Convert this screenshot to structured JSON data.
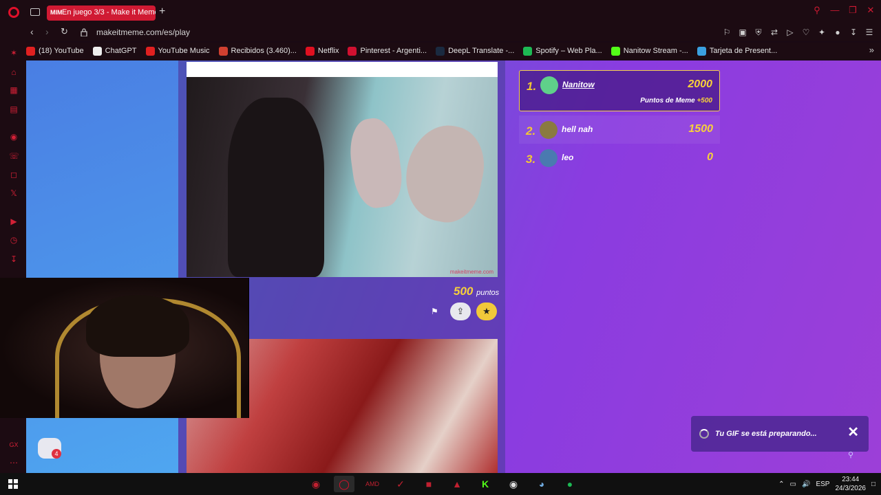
{
  "browser": {
    "tab_title": "En juego 3/3 - Make it Meme",
    "tab_favicon": "MIM",
    "url": "makeitmeme.com/es/play",
    "new_tab": "+"
  },
  "bookmarks": [
    {
      "label": "(18) YouTube",
      "color": "#e02020"
    },
    {
      "label": "ChatGPT",
      "color": "#eeeeee"
    },
    {
      "label": "YouTube Music",
      "color": "#e02020"
    },
    {
      "label": "Recibidos (3.460)...",
      "color": "#d04030"
    },
    {
      "label": "Netflix",
      "color": "#e01020"
    },
    {
      "label": "Pinterest - Argenti...",
      "color": "#d01030"
    },
    {
      "label": "DeepL Translate -...",
      "color": "#1a2a40"
    },
    {
      "label": "Spotify – Web Pla...",
      "color": "#1db954"
    },
    {
      "label": "Nanitow Stream -...",
      "color": "#53fc18"
    },
    {
      "label": "Tarjeta de Present...",
      "color": "#3aa0e0"
    }
  ],
  "meme": {
    "watermark": "makeitmeme.com",
    "points_value": "500",
    "points_unit": "puntos"
  },
  "leaderboard": [
    {
      "rank": "1.",
      "name": "Nanitow",
      "score": "2000",
      "sub_label": "Puntos de Meme",
      "sub_bonus": "+500",
      "avatar_color": "#5fd08a"
    },
    {
      "rank": "2.",
      "name": "hell nah",
      "score": "1500",
      "avatar_color": "#8a7a40"
    },
    {
      "rank": "3.",
      "name": "leo",
      "score": "0",
      "avatar_color": "#4a7ab0"
    }
  ],
  "chat": {
    "badge": "4"
  },
  "toast": {
    "text": "Tu GIF se está preparando...",
    "close": "✕"
  },
  "taskbar": {
    "lang": "ESP",
    "time": "23:44",
    "date": "24/3/2026"
  },
  "colors": {
    "accent": "#d01a33",
    "gold": "#f7d13a"
  }
}
